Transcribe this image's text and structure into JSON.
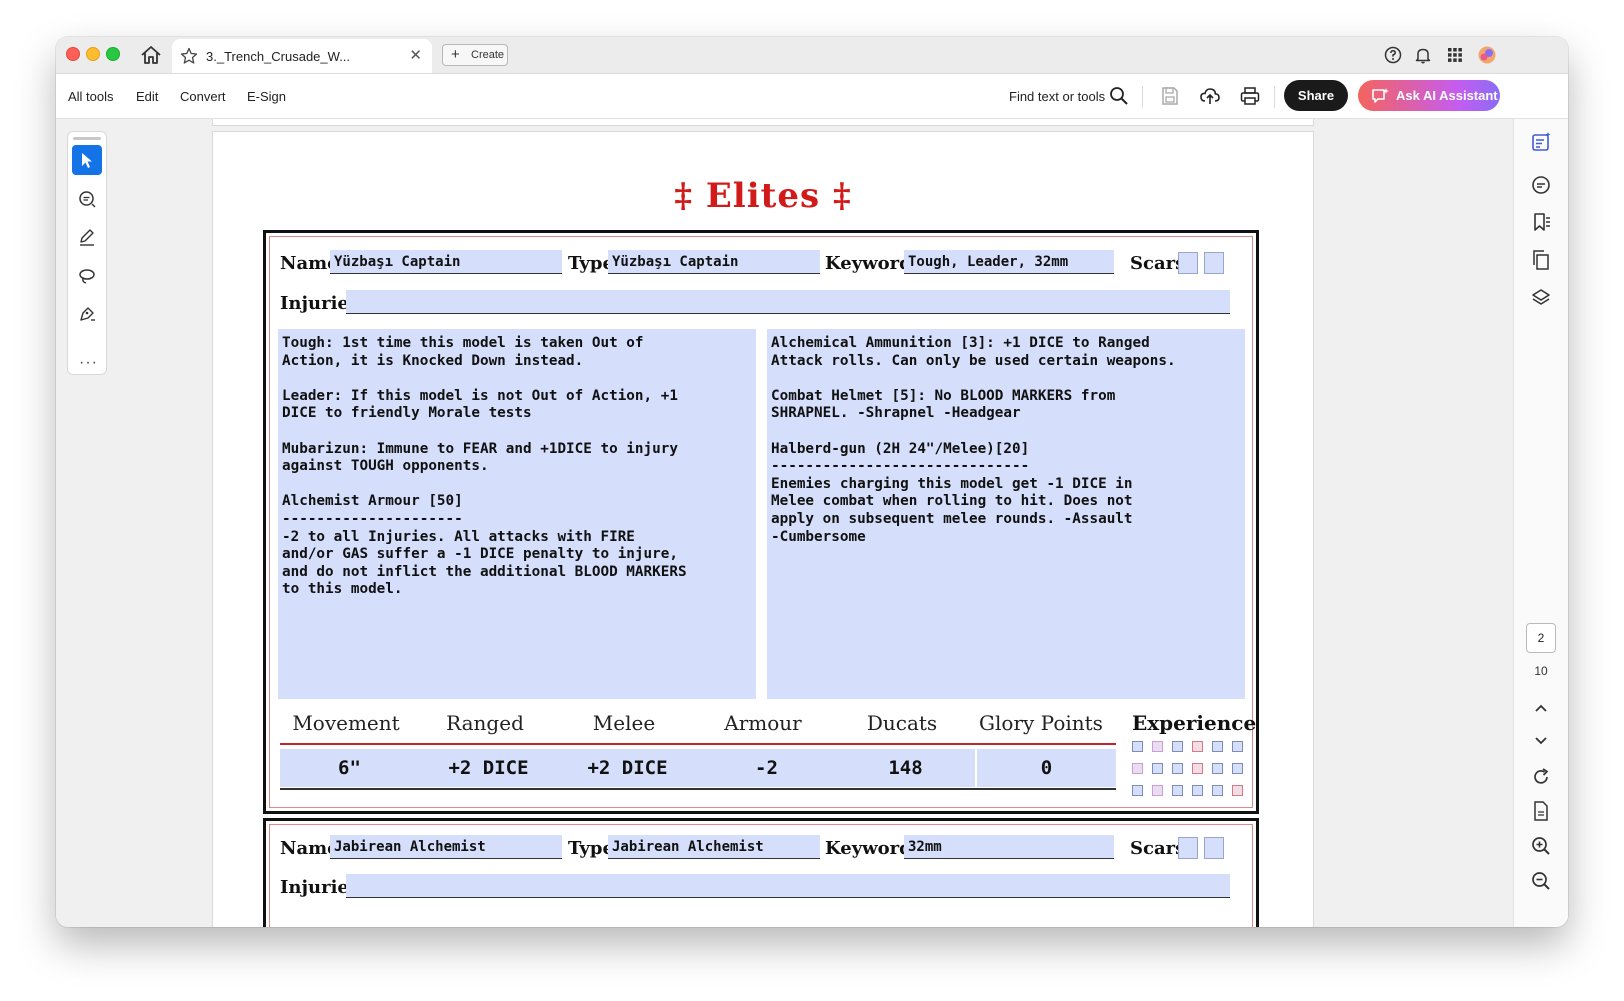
{
  "tab": {
    "title": "3._Trench_Crusade_W...",
    "close": "✕",
    "create_label": "Create"
  },
  "menu": {
    "all_tools": "All tools",
    "edit": "Edit",
    "convert": "Convert",
    "esign": "E-Sign"
  },
  "toolbar": {
    "find": "Find text or tools",
    "share": "Share",
    "ask_ai": "Ask AI Assistant"
  },
  "page_nav": {
    "current": "2",
    "total": "10"
  },
  "document": {
    "section_title": "‡ Elites ‡",
    "labels": {
      "name": "Name",
      "type": "Type",
      "keywords": "Keywords",
      "scars": "Scars",
      "injuries": "Injuries",
      "experience": "Experience"
    },
    "stat_headers": [
      "Movement",
      "Ranged",
      "Melee",
      "Armour",
      "Ducats",
      "Glory Points"
    ],
    "cards": [
      {
        "name": "Yüzbaşı Captain",
        "type": "Yüzbaşı Captain",
        "keywords": "Tough, Leader, 32mm",
        "left_text": "Tough: 1st time this model is taken Out of\nAction, it is Knocked Down instead.\n\nLeader: If this model is not Out of Action, +1\nDICE to friendly Morale tests\n\nMubarizun: Immune to FEAR and +1DICE to injury\nagainst TOUGH opponents.\n\nAlchemist Armour [50]\n---------------------\n-2 to all Injuries. All attacks with FIRE\nand/or GAS suffer a -1 DICE penalty to injure,\nand do not inflict the additional BLOOD MARKERS\nto this model.",
        "right_text": "Alchemical Ammunition [3]: +1 DICE to Ranged\nAttack rolls. Can only be used certain weapons.\n\nCombat Helmet [5]: No BLOOD MARKERS from\nSHRAPNEL. -Shrapnel -Headgear\n\nHalberd-gun (2H 24\"/Melee)[20]\n------------------------------\nEnemies charging this model get -1 DICE in\nMelee combat when rolling to hit. Does not\napply on subsequent melee rounds. -Assault\n-Cumbersome",
        "stats": [
          "6\"",
          "+2 DICE",
          "+2 DICE",
          "-2",
          "148",
          "0"
        ]
      },
      {
        "name": "Jabirean Alchemist",
        "type": "Jabirean Alchemist",
        "keywords": "32mm"
      }
    ]
  }
}
